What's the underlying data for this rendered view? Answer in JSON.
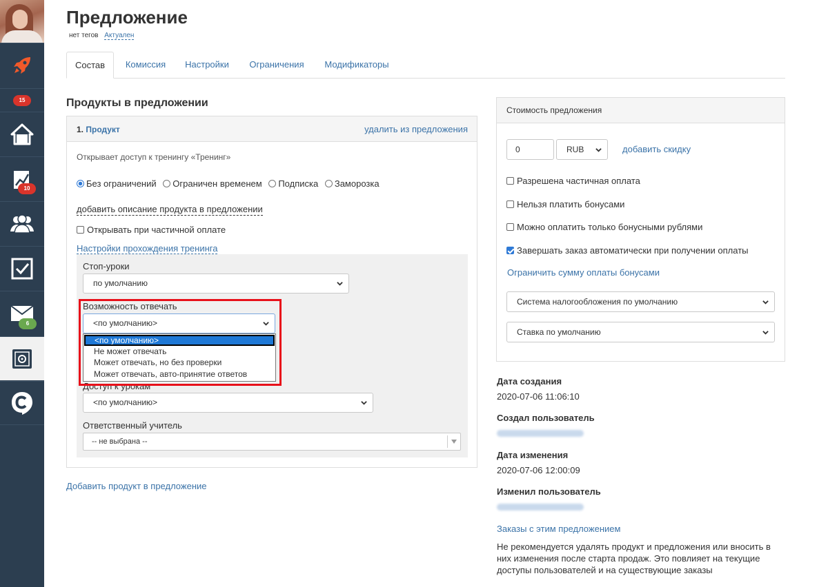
{
  "sidebar": {
    "items": [
      {
        "icon": "rocket-icon",
        "badge": ""
      },
      {
        "icon": "home-icon",
        "badge": "15"
      },
      {
        "icon": "chart-icon",
        "badge": "10"
      },
      {
        "icon": "users-icon",
        "badge": ""
      },
      {
        "icon": "checkbox-icon",
        "badge": ""
      },
      {
        "icon": "mail-icon",
        "badge": "6"
      },
      {
        "icon": "safe-icon",
        "badge": ""
      },
      {
        "icon": "chat-icon",
        "badge": ""
      }
    ],
    "colors": {
      "bg": "#2c3e50",
      "rocket": "#f1592a",
      "badge_red": "#d9342b",
      "badge_green": "#6aa84f"
    }
  },
  "header": {
    "title": "Предложение",
    "no_tags": "нет тегов",
    "status": "Актуален"
  },
  "tabs": [
    "Состав",
    "Комиссия",
    "Настройки",
    "Ограничения",
    "Модификаторы"
  ],
  "products": {
    "heading": "Продукты в предложении",
    "number": "1.",
    "name": "Продукт",
    "remove_link": "удалить из предложения",
    "access_text": "Открывает доступ к тренингу «Тренинг»",
    "radios": [
      "Без ограничений",
      "Ограничен временем",
      "Подписка",
      "Заморозка"
    ],
    "add_description": "добавить описание продукта в предложении",
    "open_partial": "Открывать при частичной оплате",
    "training_settings": "Настройки прохождения тренинга",
    "stop_lessons_label": "Стоп-уроки",
    "stop_lessons_value": "по умолчанию",
    "answer_label": "Возможность отвечать",
    "answer_value": "<по умолчанию>",
    "answer_options": [
      "<по умолчанию>",
      "Не может отвечать",
      "Может отвечать, но без проверки",
      "Может отвечать, авто-принятие ответов"
    ],
    "access_lessons_label": "Доступ к урокам",
    "access_lessons_value": "<по умолчанию>",
    "teacher_label": "Ответственный учитель",
    "teacher_value": "-- не выбрана --",
    "add_product": "Добавить продукт в предложение"
  },
  "price": {
    "heading": "Стоимость предложения",
    "amount": "0",
    "currency": "RUB",
    "add_discount": "добавить скидку",
    "checks": [
      {
        "label": "Разрешена частичная оплата",
        "checked": false
      },
      {
        "label": "Нельзя платить бонусами",
        "checked": false
      },
      {
        "label": "Можно оплатить только бонусными рублями",
        "checked": false
      },
      {
        "label": "Завершать заказ автоматически при получении оплаты",
        "checked": true
      }
    ],
    "limit_bonus": "Ограничить сумму оплаты бонусами",
    "tax_system": "Система налогообложения по умолчанию",
    "tax_rate": "Ставка по умолчанию"
  },
  "meta": {
    "created_label": "Дата создания",
    "created_value": "2020-07-06 11:06:10",
    "created_by_label": "Создал пользователь",
    "modified_label": "Дата изменения",
    "modified_value": "2020-07-06 12:00:09",
    "modified_by_label": "Изменил пользователь",
    "orders_link": "Заказы с этим предложением",
    "warning": "Не рекомендуется удалять продукт и предложения или вносить в них изменения после старта продаж. Это повлияет на текущие доступы пользователей и на существующие заказы"
  }
}
